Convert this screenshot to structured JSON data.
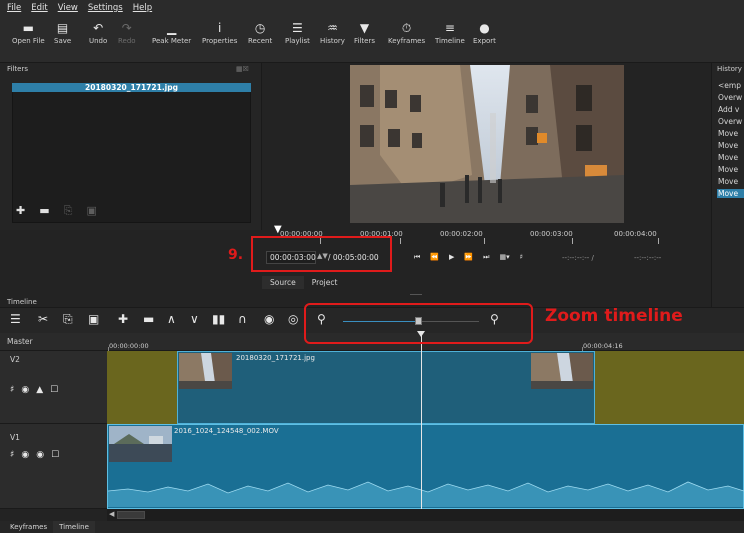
{
  "menu": [
    "File",
    "Edit",
    "View",
    "Settings",
    "Help"
  ],
  "toolbar": [
    {
      "label": "Open File",
      "icon": "folder-icon",
      "glyph": "▬"
    },
    {
      "label": "Save",
      "icon": "save-icon",
      "glyph": "▤"
    },
    {
      "label": "Undo",
      "icon": "undo-icon",
      "glyph": "↶"
    },
    {
      "label": "Redo",
      "icon": "redo-icon",
      "glyph": "↷"
    },
    {
      "label": "Peak Meter",
      "icon": "peak-meter-icon",
      "glyph": "▁"
    },
    {
      "label": "Properties",
      "icon": "info-icon",
      "glyph": "i"
    },
    {
      "label": "Recent",
      "icon": "clock-icon",
      "glyph": "◷"
    },
    {
      "label": "Playlist",
      "icon": "list-icon",
      "glyph": "☰"
    },
    {
      "label": "History",
      "icon": "history-icon",
      "glyph": "♒"
    },
    {
      "label": "Filters",
      "icon": "filter-icon",
      "glyph": "▼"
    },
    {
      "label": "Keyframes",
      "icon": "stopwatch-icon",
      "glyph": "⏱"
    },
    {
      "label": "Timeline",
      "icon": "timeline-icon",
      "glyph": "≡"
    },
    {
      "label": "Export",
      "icon": "export-icon",
      "glyph": "●"
    }
  ],
  "filters": {
    "title": "Filters",
    "selected_item": "20180320_171721.jpg"
  },
  "ruler": {
    "ticks": [
      "00:00:00:00",
      "00:00:01:00",
      "00:00:02:00",
      "00:00:03:00",
      "00:00:04:00"
    ]
  },
  "transport": {
    "current_time": "00:00:03:00",
    "total_time": "/ 00:05:00:00",
    "in_point": "--:--:--:-- /",
    "out_point": "--:--:--:--"
  },
  "source_tabs": [
    "Source",
    "Project"
  ],
  "history": {
    "title": "History",
    "items": [
      "<emp",
      "Overw",
      "Add v",
      "Overw",
      "Move",
      "Move",
      "Move",
      "Move",
      "Move",
      "Move"
    ]
  },
  "timeline": {
    "label": "Timeline",
    "master": "Master",
    "time_start": "00:00:00:00",
    "time_end": "00:00:04:16",
    "tracks": [
      {
        "name": "V2",
        "clip": "20180320_171721.jpg"
      },
      {
        "name": "V1",
        "clip": "2016_1024_124548_002.MOV"
      }
    ],
    "zoom_fraction": 0.55
  },
  "annotations": {
    "step_number": "9.",
    "zoom_label": "Zoom timeline"
  },
  "bottom_tabs": [
    "Keyframes",
    "Timeline"
  ],
  "colors": {
    "accent": "#2e7fa8",
    "annotation": "#e01b1b",
    "v2_lane": "#6a661e",
    "v1_clip": "#1a6f94"
  }
}
